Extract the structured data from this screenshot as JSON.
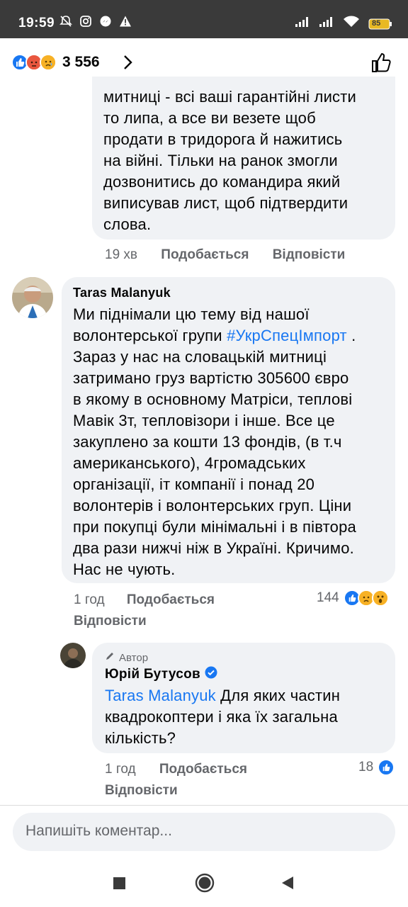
{
  "status_bar": {
    "time": "19:59",
    "battery": "85",
    "icons_left": [
      "mute-icon",
      "instagram-icon",
      "messenger-icon",
      "warning-icon"
    ],
    "icons_right": [
      "signal-icon",
      "signal-icon-2",
      "wifi-icon",
      "battery-icon"
    ]
  },
  "header": {
    "reaction_count": "3 556",
    "reactions": [
      "like",
      "angry",
      "sad"
    ]
  },
  "comment1": {
    "text": "митниці - всі ваші гарантійні листи\nто липа, а все ви везете щоб\nпродати в тридорога й нажитись\nна війні. Тільки на ранок змогли\nдозвонитись до командира який\nвиписував лист, щоб підтвердити\nслова.",
    "time": "19 хв",
    "like_label": "Подобається",
    "reply_label": "Відповісти"
  },
  "comment2": {
    "author": "Taras  Malanyuk",
    "text_before": "Ми піднімали цю тему від нашої\nволонтерської групи ",
    "hashtag": "#УкрСпецІмпорт",
    "text_after": " .\nЗараз у нас на словацькій митниці\nзатримано груз вартістю 305600 євро\nв якому в основному Матріси, теплові\nМавік 3т, тепловізори і інше. Все це\nзакуплено за кошти 13 фондів, (в т.ч\nамериканського), 4громадських\nорганізації, іт компанії і понад 20\nволонтерів і волонтерських груп. Ціни\nпри покупці були мінімальні і в півтора\nдва рази нижчі ніж в Україні. Кричимо.\nНас не чують.",
    "time": "1 год",
    "like_label": "Подобається",
    "reply_label": "Відповісти",
    "reaction_count": "144"
  },
  "comment3": {
    "badge": "Автор",
    "author": "Юрій Бутусов",
    "mention": "Taras  Malanyuk",
    "text": " Для яких частин\nквадрокоптери і яка їх загальна\nкількість?",
    "time": "1 год",
    "like_label": "Подобається",
    "reply_label": "Відповісти",
    "reaction_count": "18"
  },
  "composer": {
    "placeholder": "Напишіть коментар..."
  },
  "colors": {
    "accent": "#1877f2",
    "bubble": "#f0f2f5",
    "meta": "#65676b"
  }
}
